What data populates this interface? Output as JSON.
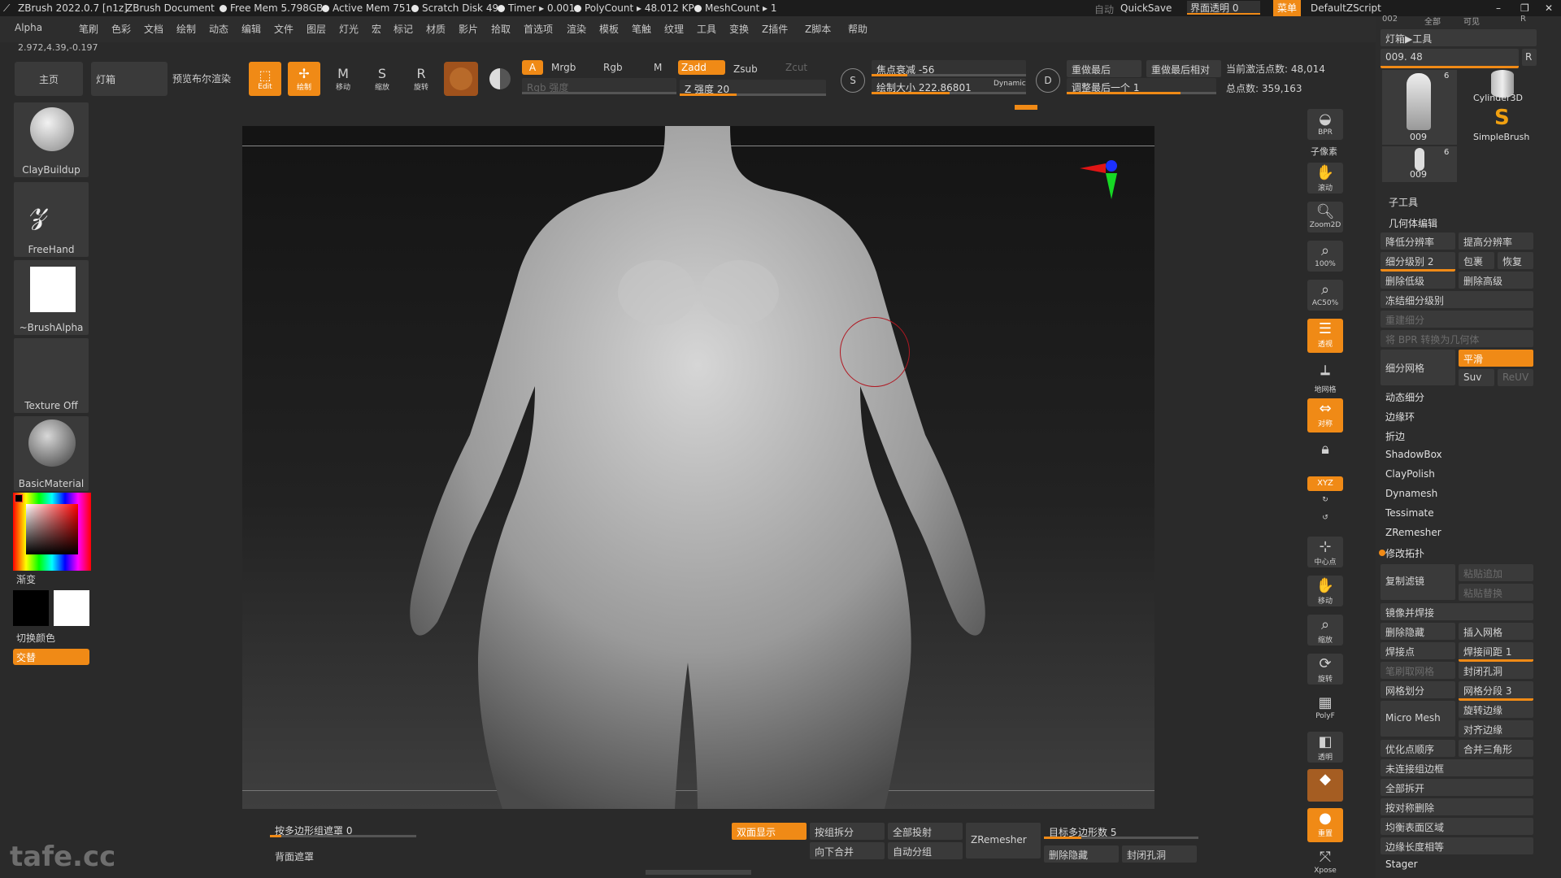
{
  "titlebar": {
    "app": "ZBrush 2022.0.7 [n1z]",
    "document": "ZBrush Document",
    "free_mem": "Free Mem 5.798GB",
    "active_mem": "Active Mem 751",
    "scratch_disk": "Scratch Disk 49",
    "timer": "Timer ▸ 0.001",
    "polycount": "PolyCount ▸ 48.012 KP",
    "meshcount": "MeshCount ▸ 1",
    "auto": "自动",
    "quicksave": "QuickSave",
    "ui_transparency": "界面透明 0",
    "menu": "菜单",
    "default_zscript": "DefaultZScript"
  },
  "menu": [
    "Alpha",
    "笔刷",
    "色彩",
    "文档",
    "绘制",
    "动态",
    "编辑",
    "文件",
    "图层",
    "灯光",
    "宏",
    "标记",
    "材质",
    "影片",
    "拾取",
    "首选项",
    "渲染",
    "模板",
    "笔触",
    "纹理",
    "工具",
    "变换",
    "Z插件",
    "Z脚本",
    "帮助"
  ],
  "coords": "2.972,4.39,-0.197",
  "shelf": {
    "home": "主页",
    "lightbox": "灯箱",
    "preview_bool": "预览布尔渲染",
    "edit": "Edit",
    "draw": "绘制",
    "move": "移动",
    "scale": "缩放",
    "rotate": "旋转",
    "a": "A",
    "mrgb": "Mrgb",
    "rgb": "Rgb",
    "m": "M",
    "zadd": "Zadd",
    "zsub": "Zsub",
    "zcut": "Zcut",
    "rgb_intensity": "Rgb 强度",
    "z_intensity": "Z 强度 20",
    "focal_shift": "焦点衰减 -56",
    "draw_size": "绘制大小 222.86801",
    "dynamic": "Dynamic",
    "replay_last": "重做最后",
    "replay_last_rel": "重做最后相对",
    "adjust_last": "调整最后一个 1",
    "active_points": "当前激活点数: 48,014",
    "total_points": "总点数: 359,163"
  },
  "left": {
    "brush": "ClayBuildup",
    "stroke": "FreeHand",
    "alpha": "~BrushAlpha",
    "texture": "Texture Off",
    "material": "BasicMaterial",
    "gradient": "渐变",
    "switch_color": "切换颜色",
    "alternate": "交替"
  },
  "right_toolbar": [
    "BPR",
    "子像素",
    "滚动",
    "Zoom2D",
    "100%",
    "AC50%",
    "透视",
    "地网格",
    "对称",
    "",
    "XYZ",
    "",
    "",
    "中心点",
    "移动",
    "缩放",
    "旋转",
    "PolyF",
    "透明",
    "",
    "重置",
    "Xpose"
  ],
  "rpanel": {
    "top_labels": [
      "002",
      "全部",
      "可见",
      "R"
    ],
    "lightbox_tool": "灯箱▶工具",
    "tool_value": "009. 48",
    "tools": [
      {
        "name": "009",
        "count": "6"
      },
      {
        "name": "Cylinder3D"
      },
      {
        "name": "SimpleBrush"
      },
      {
        "name": "009",
        "count": "6"
      }
    ],
    "subtool": "子工具",
    "geometry": "几何体编辑",
    "lower_res": "降低分辨率",
    "higher_res": "提高分辨率",
    "sdiv": "细分级别 2",
    "cage": "包裹",
    "restore": "恢复",
    "del_lower": "删除低级",
    "del_higher": "删除高级",
    "freeze_sdiv": "冻结细分级别",
    "reconstruct": "重建细分",
    "bpr_to_geo": "将 BPR 转换为几何体",
    "divide": "细分网格",
    "smooth": "平滑",
    "suv": "Suv",
    "reuv": "ReUV",
    "dynamic_sub": "动态细分",
    "edge_loop": "边缘环",
    "crease": "折边",
    "shadowbox": "ShadowBox",
    "claypolish": "ClayPolish",
    "dynamesh": "Dynamesh",
    "tessimate": "Tessimate",
    "zremesher": "ZRemesher",
    "modify_topo": "修改拓扑",
    "copy": "复制滤镜",
    "paste_append": "粘贴追加",
    "paste_replace": "粘贴替换",
    "mirror_weld": "镜像并焊接",
    "del_hidden": "删除隐藏",
    "insert_mesh": "插入网格",
    "weld_points": "焊接点",
    "weld_dist": "焊接间距 1",
    "stroke_close": "笔刷取网格",
    "close_holes": "封闭孔洞",
    "grid_divide": "网格划分",
    "mesh_segments": "网格分段 3",
    "micro_mesh": "Micro Mesh",
    "spin_edge": "旋转边缘",
    "align_edge": "对齐边缘",
    "optimize": "优化点顺序",
    "merge_tri": "合并三角形",
    "unweld_groups": "未连接组边框",
    "unweld_all": "全部拆开",
    "delete_by_sym": "按对称删除",
    "equalize_area": "均衡表面区域",
    "equalize_edge": "边缘长度相等",
    "stager": "Stager"
  },
  "bottom": {
    "mask_by_polygroup": "按多边形组遮罩 0",
    "backface_mask": "背面遮罩",
    "double": "双面显示",
    "group_split": "按组拆分",
    "project_all": "全部投射",
    "merge_down": "向下合并",
    "auto_groups": "自动分组",
    "zremesher": "ZRemesher",
    "target_poly": "目标多边形数 5",
    "del_hidden": "删除隐藏",
    "close_holes": "封闭孔洞"
  },
  "watermark": "tafe.cc"
}
